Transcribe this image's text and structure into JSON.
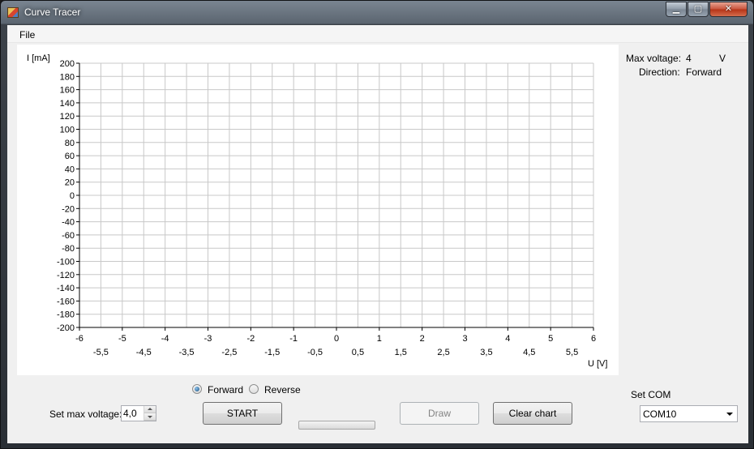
{
  "window": {
    "title": "Curve Tracer",
    "minimize": "▁",
    "maximize": "▢",
    "close": "✕"
  },
  "menu": {
    "file": "File"
  },
  "chart_data": {
    "type": "line",
    "ylabel": "I [mA]",
    "xlabel": "U [V]",
    "xlim": [
      -6,
      6
    ],
    "ylim": [
      -200,
      200
    ],
    "x_ticks_major": [
      "-6",
      "-5",
      "-4",
      "-3",
      "-2",
      "-1",
      "0",
      "1",
      "2",
      "3",
      "4",
      "5",
      "6"
    ],
    "x_ticks_minor": [
      "-5,5",
      "-4,5",
      "-3,5",
      "-2,5",
      "-1,5",
      "-0,5",
      "0,5",
      "1,5",
      "2,5",
      "3,5",
      "4,5",
      "5,5"
    ],
    "y_ticks": [
      "200",
      "180",
      "160",
      "140",
      "120",
      "100",
      "80",
      "60",
      "40",
      "20",
      "0",
      "-20",
      "-40",
      "-60",
      "-80",
      "-100",
      "-120",
      "-140",
      "-160",
      "-180",
      "-200"
    ],
    "grid": true,
    "series": []
  },
  "info": {
    "max_voltage_label": "Max voltage:",
    "max_voltage_value": "4",
    "max_voltage_unit": "V",
    "direction_label": "Direction:",
    "direction_value": "Forward"
  },
  "controls": {
    "forward_label": "Forward",
    "reverse_label": "Reverse",
    "set_max_voltage_label": "Set max voltage:",
    "max_voltage_input": "4,0",
    "start_label": "START",
    "draw_label": "Draw",
    "clear_label": "Clear chart",
    "set_com_label": "Set COM",
    "com_value": "COM10",
    "progress": 0
  }
}
